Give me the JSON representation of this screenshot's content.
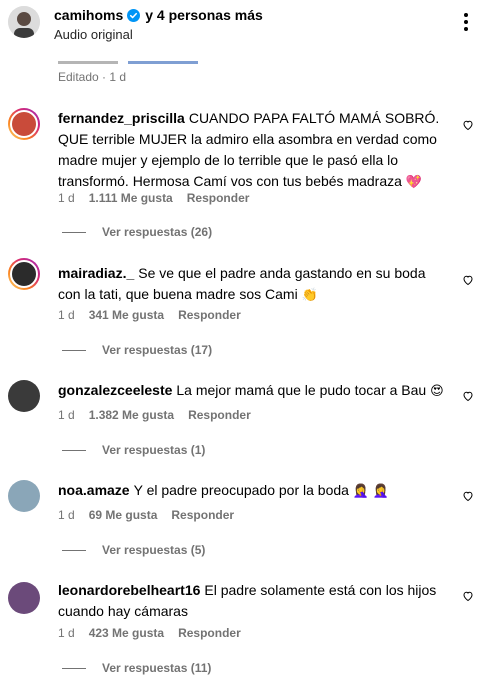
{
  "header": {
    "username": "camihoms",
    "others": "y 4 personas más",
    "subtitle": "Audio original"
  },
  "edited_line": "Editado · 1 d",
  "comments": [
    {
      "username": "fernandez_priscilla",
      "text": "CUANDO PAPA FALTÓ MAMÁ SOBRÓ. QUE terrible MUJER la admiro ella asombra en verdad como madre mujer y ejemplo de lo terrible que le pasó ella lo transformó. Hermosa Camí vos con tus bebés madraza",
      "emoji": "💖",
      "time": "1 d",
      "likes": "1.111 Me gusta",
      "reply": "Responder",
      "view_replies": "Ver respuestas (26)"
    },
    {
      "username": "mairadiaz._",
      "text": "Se ve que el padre anda gastando en su boda con la tati, que buena madre sos Cami",
      "emoji": "👏",
      "time": "1 d",
      "likes": "341 Me gusta",
      "reply": "Responder",
      "view_replies": "Ver respuestas (17)"
    },
    {
      "username": "gonzalezceeleste",
      "text": "La mejor mamá que le pudo tocar a Bau",
      "emoji": "😍",
      "time": "1 d",
      "likes": "1.382 Me gusta",
      "reply": "Responder",
      "view_replies": "Ver respuestas (1)"
    },
    {
      "username": "noa.amaze",
      "text": "Y el padre preocupado por la boda",
      "emoji": "🤦‍♀️ 🤦‍♀️",
      "time": "1 d",
      "likes": "69 Me gusta",
      "reply": "Responder",
      "view_replies": "Ver respuestas (5)"
    },
    {
      "username": "leonardorebelheart16",
      "text": "El padre solamente está con los hijos cuando hay cámaras",
      "emoji": "",
      "time": "1 d",
      "likes": "423 Me gusta",
      "reply": "Responder",
      "view_replies": "Ver respuestas (11)"
    }
  ],
  "colors": {
    "verified": "#0095f6",
    "muted": "#737373"
  },
  "icons": {
    "more": "more-vertical-icon",
    "like": "heart-outline-icon",
    "verified": "verified-badge-icon"
  }
}
